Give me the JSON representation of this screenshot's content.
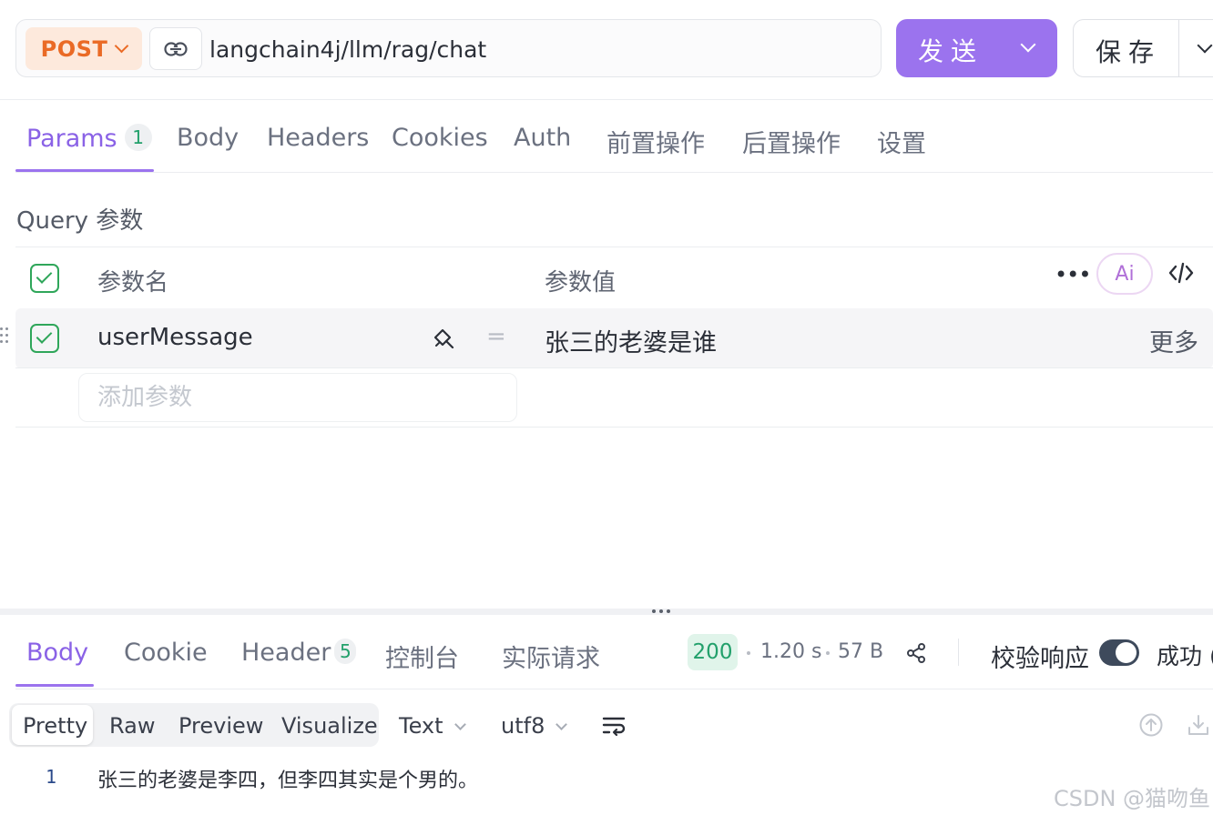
{
  "request": {
    "method": "POST",
    "url": "langchain4j/llm/rag/chat",
    "send_label": "发送",
    "save_label": "保存"
  },
  "tabs": [
    {
      "label": "Params",
      "badge": "1"
    },
    {
      "label": "Body"
    },
    {
      "label": "Headers"
    },
    {
      "label": "Cookies"
    },
    {
      "label": "Auth"
    },
    {
      "label": "前置操作"
    },
    {
      "label": "后置操作"
    },
    {
      "label": "设置"
    }
  ],
  "params": {
    "section_title": "Query 参数",
    "col_name": "参数名",
    "col_value": "参数值",
    "ai_label": "Ai",
    "rows": [
      {
        "name": "userMessage",
        "eq": "=",
        "value": "张三的老婆是谁",
        "more": "更多"
      }
    ],
    "add_placeholder": "添加参数"
  },
  "response": {
    "tabs": [
      {
        "label": "Body"
      },
      {
        "label": "Cookie"
      },
      {
        "label": "Header",
        "badge": "5"
      },
      {
        "label": "控制台"
      },
      {
        "label": "实际请求"
      }
    ],
    "status": "200",
    "time": "1.20 s",
    "size": "57 B",
    "validate_label": "校验响应",
    "result": "成功 (",
    "view_modes": [
      "Pretty",
      "Raw",
      "Preview",
      "Visualize"
    ],
    "format": "Text",
    "encoding": "utf8",
    "lines": [
      {
        "no": "1",
        "text": "张三的老婆是李四，但李四其实是个男的。"
      }
    ]
  },
  "watermark": "CSDN @猫吻鱼",
  "colors": {
    "accent": "#9b73ee",
    "method": "#ea6a25",
    "success": "#22a06b"
  }
}
